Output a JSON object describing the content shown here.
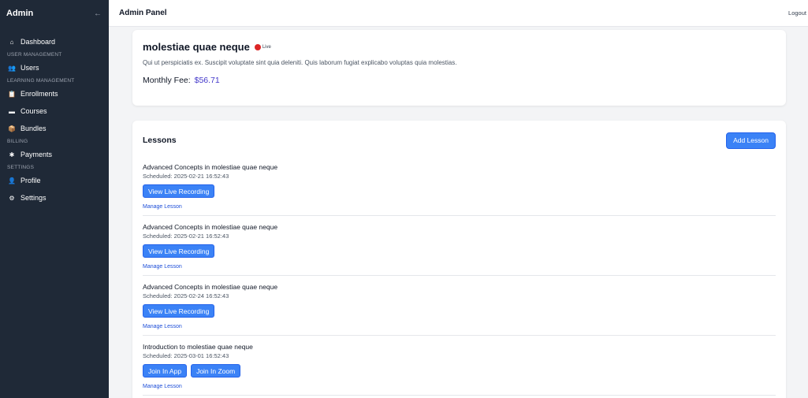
{
  "sidebar": {
    "title": "Admin",
    "collapse_icon": "←",
    "items": [
      {
        "type": "item",
        "label": "Dashboard",
        "icon": "home-icon",
        "glyph": "⌂"
      },
      {
        "type": "section",
        "label": "USER MANAGEMENT"
      },
      {
        "type": "item",
        "label": "Users",
        "icon": "users-icon",
        "glyph": "👥"
      },
      {
        "type": "section",
        "label": "LEARNING MANAGEMENT"
      },
      {
        "type": "item",
        "label": "Enrollments",
        "icon": "enrollments-icon",
        "glyph": "📋"
      },
      {
        "type": "item",
        "label": "Courses",
        "icon": "courses-icon",
        "glyph": "▬"
      },
      {
        "type": "item",
        "label": "Bundles",
        "icon": "bundles-icon",
        "glyph": "📦"
      },
      {
        "type": "section",
        "label": "BILLING"
      },
      {
        "type": "item",
        "label": "Payments",
        "icon": "payments-icon",
        "glyph": "✱"
      },
      {
        "type": "section",
        "label": "SETTINGS"
      },
      {
        "type": "item",
        "label": "Profile",
        "icon": "profile-icon",
        "glyph": "👤"
      },
      {
        "type": "item",
        "label": "Settings",
        "icon": "gear-icon",
        "glyph": "⚙"
      }
    ]
  },
  "topbar": {
    "title": "Admin Panel",
    "logout": "Logout"
  },
  "course": {
    "title": "molestiae quae neque",
    "live_label": "Live",
    "live_color": "#dc2626",
    "description": "Qui ut perspiciatis ex. Suscipit voluptate sint quia deleniti. Quis laborum fugiat explicabo voluptas quia molestias.",
    "fee_label": "Monthly Fee:",
    "fee_value": "$56.71"
  },
  "lessons": {
    "title": "Lessons",
    "add_label": "Add Lesson",
    "manage_label": "Manage Lesson",
    "items": [
      {
        "title": "Advanced Concepts in molestiae quae neque",
        "scheduled": "Scheduled: 2025-02-21 16:52:43",
        "actions": [
          "View Live Recording"
        ]
      },
      {
        "title": "Advanced Concepts in molestiae quae neque",
        "scheduled": "Scheduled: 2025-02-21 16:52:43",
        "actions": [
          "View Live Recording"
        ]
      },
      {
        "title": "Advanced Concepts in molestiae quae neque",
        "scheduled": "Scheduled: 2025-02-24 16:52:43",
        "actions": [
          "View Live Recording"
        ]
      },
      {
        "title": "Introduction to molestiae quae neque",
        "scheduled": "Scheduled: 2025-03-01 16:52:43",
        "actions": [
          "Join In App",
          "Join In Zoom"
        ]
      }
    ]
  },
  "colors": {
    "sidebar_bg": "#1f2937",
    "primary": "#3b82f6",
    "fee": "#4338ca",
    "link": "#1d4ed8"
  }
}
